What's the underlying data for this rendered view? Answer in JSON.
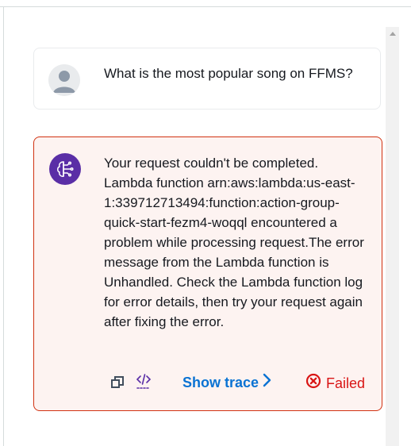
{
  "conversation": {
    "user_message": {
      "text": "What is the most popular song on FFMS?"
    },
    "agent_message": {
      "text": "Your request couldn't be completed. Lambda function arn:aws:lambda:us-east-1:339712713494:function:action-group-quick-start-fezm4-woqql encountered a problem while processing request.The error message from the Lambda function is Unhandled. Check the Lambda function log for error details, then try your request again after fixing the error.",
      "show_trace_label": "Show trace",
      "status_label": "Failed"
    }
  },
  "colors": {
    "error": "#d91515",
    "error_border": "#d13212",
    "error_bg": "#fdf3f1",
    "link": "#0972d3",
    "agent_avatar": "#5a2ea6"
  },
  "icons": {
    "user_avatar": "user-avatar-icon",
    "agent_avatar": "brain-circuit-icon",
    "copy": "copy-icon",
    "code": "code-icon",
    "trace_chevron": "chevron-right-icon",
    "status": "error-circle-icon"
  }
}
